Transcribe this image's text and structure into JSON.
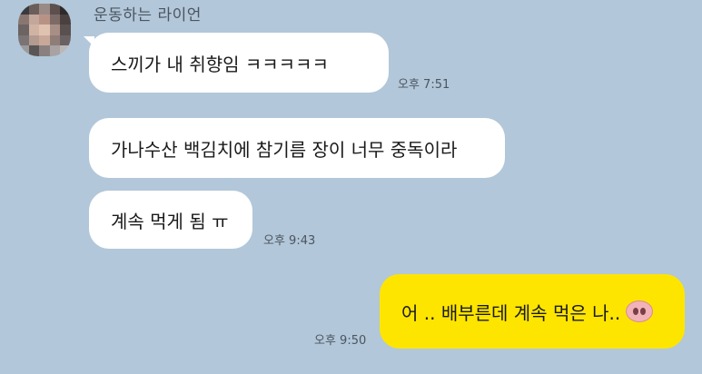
{
  "chat": {
    "sender_name": "운동하는 라이언",
    "messages": [
      {
        "text": "스끼가 내 취향임 ㅋㅋㅋㅋㅋ",
        "time": "오후 7:51"
      },
      {
        "text": "가나수산 백김치에 참기름 장이 너무 중독이라",
        "time": ""
      },
      {
        "text": "계속 먹게 됨 ㅠ",
        "time": "오후 9:43"
      }
    ],
    "my_message": {
      "text": "어 .. 배부른데 계속 먹은 나..",
      "emoji": "pig-nose-emoji",
      "time": "오후 9:50"
    }
  },
  "colors": {
    "background": "#b2c7d9",
    "incoming_bubble": "#ffffff",
    "outgoing_bubble": "#fee500"
  }
}
